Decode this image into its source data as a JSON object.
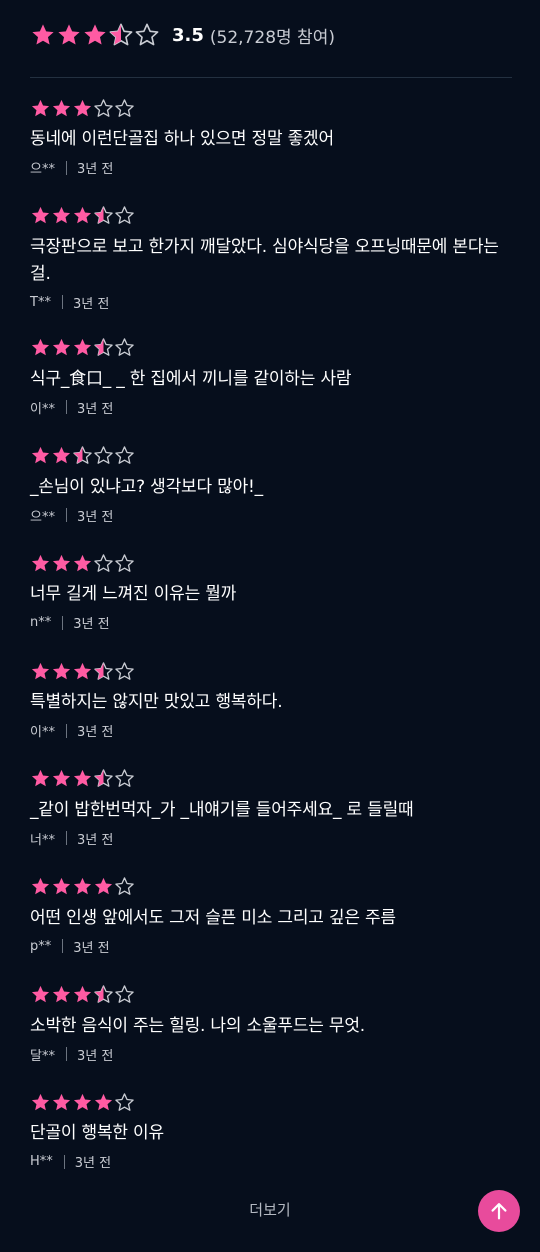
{
  "colors": {
    "background": "#060e1c",
    "star_filled": "#ff5ba3",
    "star_empty_outline": "#c9ccd3",
    "accent_button": "#e84b9c"
  },
  "summary": {
    "rating": 3.5,
    "average": "3.5",
    "count": "(52,728명 참여)"
  },
  "reviews": [
    {
      "rating": 3,
      "text": "동네에 이런단골집 하나 있으면 정말 좋겠어",
      "author": "으**",
      "time": "3년 전"
    },
    {
      "rating": 3.5,
      "text": "극장판으로 보고 한가지 깨달았다. 심야식당을 오프닝때문에 본다는 걸.",
      "author": "T**",
      "time": "3년 전"
    },
    {
      "rating": 3.5,
      "text": "식구_食口_ _ 한 집에서 끼니를 같이하는 사람",
      "author": "이**",
      "time": "3년 전"
    },
    {
      "rating": 2.5,
      "text": "_손님이 있냐고? 생각보다 많아!_",
      "author": "으**",
      "time": "3년 전"
    },
    {
      "rating": 3,
      "text": "너무 길게 느껴진 이유는 뭘까",
      "author": "n**",
      "time": "3년 전"
    },
    {
      "rating": 3.5,
      "text": "특별하지는 않지만 맛있고 행복하다.",
      "author": "이**",
      "time": "3년 전"
    },
    {
      "rating": 3.5,
      "text": "_같이 밥한번먹자_가 _내얘기를 들어주세요_ 로 들릴때",
      "author": "너**",
      "time": "3년 전"
    },
    {
      "rating": 4,
      "text": "어떤 인생 앞에서도 그저 슬픈 미소 그리고 깊은 주름",
      "author": "p**",
      "time": "3년 전"
    },
    {
      "rating": 3.5,
      "text": "소박한 음식이 주는 힐링. 나의 소울푸드는 무엇.",
      "author": "달**",
      "time": "3년 전"
    },
    {
      "rating": 4,
      "text": "단골이 행복한 이유",
      "author": "H**",
      "time": "3년 전"
    }
  ],
  "more_label": "더보기",
  "icons": {
    "star": "star-icon",
    "scroll_top": "arrow-up-icon"
  }
}
